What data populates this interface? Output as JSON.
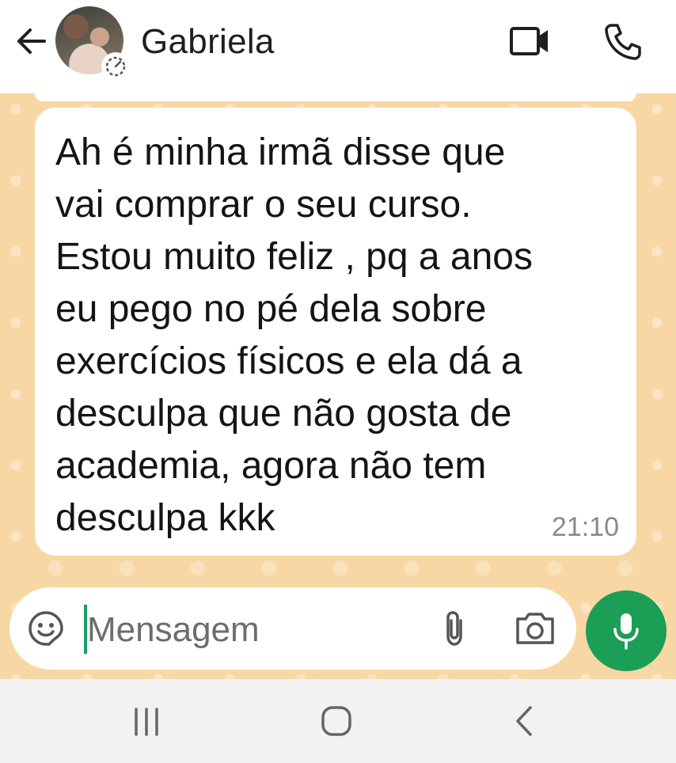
{
  "header": {
    "contact_name": "Gabriela",
    "back_icon": "arrow-left-icon",
    "video_icon": "video-camera-icon",
    "call_icon": "phone-icon"
  },
  "chat": {
    "wallpaper_color": "#f7d7a4",
    "message": {
      "text": "Ah é minha irmã disse que\nvai comprar o seu curso.\nEstou muito feliz , pq a anos\neu pego no pé dela sobre\nexercícios físicos e ela dá a\ndesculpa que não gosta de\nacademia,  agora não tem\ndesculpa kkk",
      "time": "21:10"
    }
  },
  "composer": {
    "placeholder": "Mensagem",
    "value": "",
    "accent_color": "#1b9e55"
  },
  "navbar": {
    "recents_icon": "recents-icon",
    "home_icon": "home-icon",
    "back_icon": "chevron-left-icon"
  }
}
